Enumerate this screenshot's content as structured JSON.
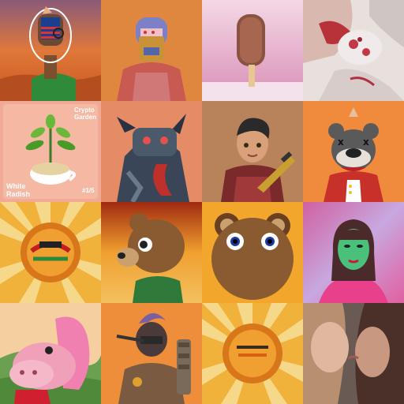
{
  "grid": {
    "rows": 4,
    "cols": 4,
    "tiles": [
      {
        "name": "ape-with-flag-helmet",
        "bg": "#e0783a"
      },
      {
        "name": "helmeted-figure",
        "bg": "#e0873f"
      },
      {
        "name": "ice-cream-bar",
        "bg": "#e6a6c8"
      },
      {
        "name": "blood-stained-photo",
        "bg": "#e8e0dc"
      },
      {
        "name": "crypto-garden-card",
        "bg": "#f0aa95",
        "texts": {
          "brand_line1": "Crypto",
          "brand_line2": "Garden",
          "item_line1": "White",
          "item_line2": "Radish",
          "edition": "#1/5"
        }
      },
      {
        "name": "dragon-robot",
        "bg": "#e58c66"
      },
      {
        "name": "boy-with-rifle",
        "bg": "#b8835a"
      },
      {
        "name": "cartoon-rat-with-cape",
        "bg": "#f08a3c"
      },
      {
        "name": "sunburst-badge-1",
        "bg": "#f0b23a"
      },
      {
        "name": "bear-head-profile",
        "bg": "#e8902a"
      },
      {
        "name": "bear-face-front",
        "bg": "#f2a72c"
      },
      {
        "name": "green-woman-portrait",
        "bg": "#c07ab8"
      },
      {
        "name": "pink-hippo",
        "bg": "#6aa050"
      },
      {
        "name": "armored-warrior",
        "bg": "#ef8e3a"
      },
      {
        "name": "sunburst-badge-2",
        "bg": "#f0b23a"
      },
      {
        "name": "two-women-photo",
        "bg": "#8a6a5c"
      }
    ]
  }
}
